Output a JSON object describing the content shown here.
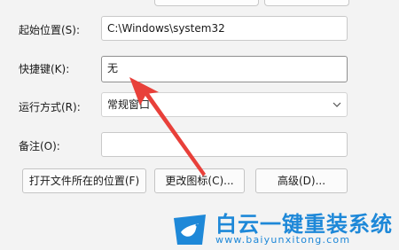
{
  "form": {
    "start_in": {
      "label": "起始位置(S):",
      "value": "C:\\Windows\\system32"
    },
    "shortcut_key": {
      "label": "快捷键(K):",
      "value": "无"
    },
    "run": {
      "label": "运行方式(R):",
      "value": "常规窗口"
    },
    "comment": {
      "label": "备注(O):",
      "value": ""
    }
  },
  "buttons": {
    "open_location": "打开文件所在的位置(F)",
    "change_icon": "更改图标(C)...",
    "advanced": "高级(D)..."
  },
  "watermark": {
    "brand": "白云一键重装系统",
    "url": "www.baiyunxitong.com"
  },
  "colors": {
    "arrow": "#e8403a",
    "brand": "#1e88d8"
  },
  "icons": {
    "dropdown": "chevron-down-icon",
    "arrow": "red-arrow-annotation",
    "logo": "bird-logo-icon"
  }
}
